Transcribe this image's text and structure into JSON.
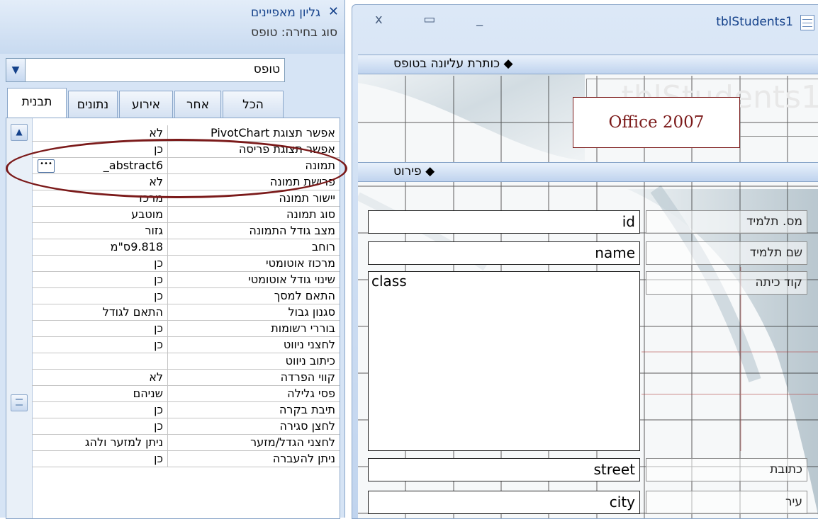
{
  "property_sheet": {
    "title": "גליון מאפיינים",
    "close_glyph": "✕",
    "selection_type": "סוג בחירה:  טופס",
    "object_combo_value": "טופס",
    "tabs": [
      {
        "label": "תבנית",
        "active": true
      },
      {
        "label": "נתונים",
        "active": false
      },
      {
        "label": "אירוע",
        "active": false
      },
      {
        "label": "אחר",
        "active": false
      },
      {
        "label": "הכל",
        "active": false
      }
    ],
    "rows": [
      {
        "label": "אפשר תצוגת PivotChart",
        "value": "לא"
      },
      {
        "label": "אפשר תצוגת פריסה",
        "value": "כן"
      },
      {
        "label": "תמונה",
        "value": "abstract6_",
        "has_builder": true
      },
      {
        "label": "פרישת תמונה",
        "value": "לא"
      },
      {
        "label": "יישור תמונה",
        "value": "מרכז"
      },
      {
        "label": "סוג תמונה",
        "value": "מוטבע"
      },
      {
        "label": "מצב גודל התמונה",
        "value": "גזור"
      },
      {
        "label": "רוחב",
        "value": "9.818ס\"מ"
      },
      {
        "label": "מרכוז אוטומטי",
        "value": "כן"
      },
      {
        "label": "שינוי גודל אוטומטי",
        "value": "כן"
      },
      {
        "label": "התאם למסך",
        "value": "כן"
      },
      {
        "label": "סגנון גבול",
        "value": "התאם לגודל"
      },
      {
        "label": "בוררי רשומות",
        "value": "כן"
      },
      {
        "label": "לחצני ניווט",
        "value": "כן"
      },
      {
        "label": "כיתוב ניווט",
        "value": ""
      },
      {
        "label": "קווי הפרדה",
        "value": "לא"
      },
      {
        "label": "פסי גלילה",
        "value": "שניהם"
      },
      {
        "label": "תיבת בקרה",
        "value": "כן"
      },
      {
        "label": "לחצן סגירה",
        "value": "כן"
      },
      {
        "label": "לחצני הגדל/מזער",
        "value": "ניתן למזער ולהג"
      },
      {
        "label": "ניתן להעברה",
        "value": "כן"
      }
    ]
  },
  "form_window": {
    "title": "tblStudents1",
    "controls_glyphs": "x ▭ _",
    "header_band": "כותרת עליונה בטופס",
    "detail_band": "פירוט",
    "header_title_text": "tblStudents1",
    "fields": [
      {
        "label": "מס. תלמיד",
        "value": "id"
      },
      {
        "label": "שם תלמיד",
        "value": "name"
      },
      {
        "label": "קוד כיתה",
        "value": "class"
      },
      {
        "label": "כתובת",
        "value": "street"
      },
      {
        "label": "עיר",
        "value": "city"
      }
    ]
  },
  "annotation": {
    "callout_text": "Office 2007"
  },
  "colors": {
    "accent_blue": "#15428b",
    "annotation_red": "#7b1a1a",
    "panel_bg": "#d6e4f5"
  }
}
